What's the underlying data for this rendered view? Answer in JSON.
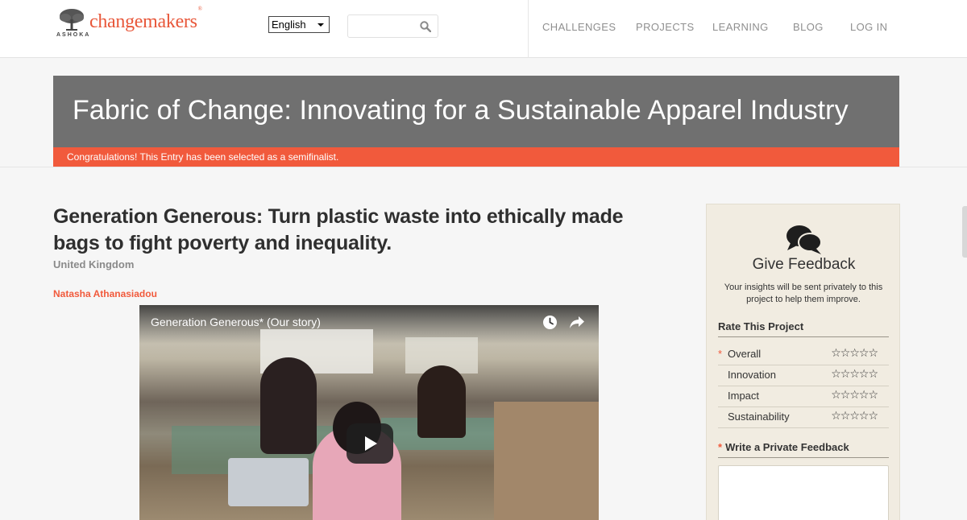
{
  "header": {
    "brand": "changemakers",
    "brand_mark": "®",
    "org": "ASHOKA",
    "language": "English",
    "search_placeholder": "",
    "nav": [
      "CHALLENGES",
      "PROJECTS",
      "LEARNING",
      "BLOG",
      "LOG IN"
    ]
  },
  "banner": {
    "title": "Fabric of Change: Innovating for a Sustainable Apparel Industry",
    "status": "Congratulations! This Entry has been selected as a semifinalist."
  },
  "entry": {
    "title": "Generation Generous: Turn plastic waste into ethically made bags to fight poverty and inequality.",
    "country": "United Kingdom",
    "author": "Natasha Athanasiadou"
  },
  "video": {
    "title": "Generation Generous* (Our story)"
  },
  "feedback": {
    "heading": "Give Feedback",
    "note": "Your insights will be sent privately to this project to help them improve.",
    "rate_heading": "Rate This Project",
    "criteria": [
      {
        "label": "Overall",
        "required": true,
        "stars": "☆☆☆☆☆"
      },
      {
        "label": "Innovation",
        "required": false,
        "stars": "☆☆☆☆☆"
      },
      {
        "label": "Impact",
        "required": false,
        "stars": "☆☆☆☆☆"
      },
      {
        "label": "Sustainability",
        "required": false,
        "stars": "☆☆☆☆☆"
      }
    ],
    "write_label": "Write a Private Feedback",
    "required_mark": "*"
  },
  "colors": {
    "accent": "#f15a3c",
    "banner": "#707070",
    "sidebar": "#f1ece1"
  }
}
